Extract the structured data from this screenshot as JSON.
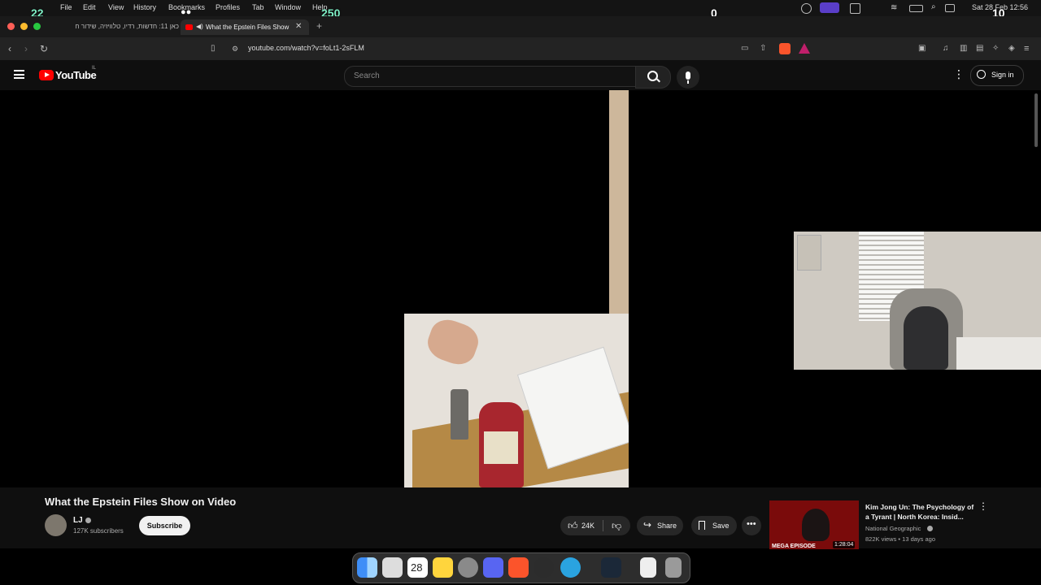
{
  "menubar": {
    "items": [
      "File",
      "Edit",
      "View",
      "History",
      "Bookmarks",
      "Profiles",
      "Tab",
      "Window",
      "Help"
    ],
    "clock": "Sat 28 Feb  12:56",
    "overlay_numbers": [
      "22",
      "250",
      "0",
      "10"
    ]
  },
  "tabs": [
    {
      "label": "כאן 11: חדשות, רדיו, טלוויזיה, שידור ח",
      "active": false
    },
    {
      "label": "What the Epstein Files Show",
      "active": true
    }
  ],
  "address": {
    "url": "youtube.com/watch?v=foLt1-2sFLM"
  },
  "youtube": {
    "logo_text": "YouTube",
    "region": "IL",
    "search_placeholder": "Search",
    "signin_label": "Sign in"
  },
  "video": {
    "title": "What the Epstein Files Show on Video",
    "channel": "LJ",
    "subscribers": "127K subscribers",
    "subscribe_label": "Subscribe",
    "likes": "24K",
    "share_label": "Share",
    "save_label": "Save"
  },
  "recommendation": {
    "title": "Kim Jong Un: The Psychology of a Tyrant | North Korea: Insid...",
    "channel": "National Geographic",
    "meta": "822K views • 13 days ago",
    "duration": "1:28:04",
    "thumb_label": "MEGA EPISODE"
  },
  "dock": {
    "apps": [
      "finder",
      "launchpad",
      "calendar",
      "notes",
      "system-settings",
      "discord",
      "brave",
      "safari",
      "telegram",
      "steam",
      "file",
      "trash"
    ],
    "calendar_day": "28"
  },
  "colors": {
    "yt_red": "#ff0000",
    "link_blue": "#3ea6ff",
    "accent_green": "#7ef0c6"
  }
}
